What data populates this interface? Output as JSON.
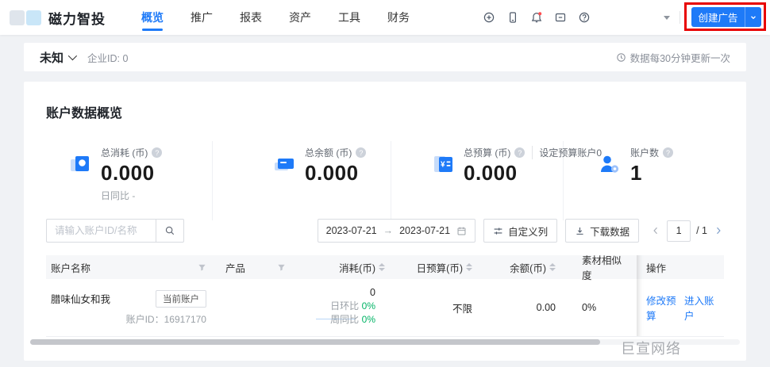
{
  "topnav": {
    "brand": "磁力智投",
    "menu": [
      {
        "label": "概览"
      },
      {
        "label": "推广"
      },
      {
        "label": "报表"
      },
      {
        "label": "资产"
      },
      {
        "label": "工具"
      },
      {
        "label": "财务"
      }
    ],
    "create_ad_label": "创建广告"
  },
  "subheader": {
    "account_name": "未知",
    "enterprise_id": "企业ID: 0",
    "update_note": "数据每30分钟更新一次"
  },
  "overview": {
    "title": "账户数据概览",
    "cards": [
      {
        "label": "总消耗 (币)",
        "value": "0.000",
        "sub": "日同比 -"
      },
      {
        "label": "总余额 (币)",
        "value": "0.000"
      },
      {
        "label": "总预算 (币)",
        "extra": "设定预算账户0",
        "value": "0.000"
      },
      {
        "label": "账户数",
        "value": "1"
      }
    ]
  },
  "filters": {
    "search_placeholder": "请输入账户ID/名称",
    "date_start": "2023-07-21",
    "date_separator": "→",
    "date_end": "2023-07-21",
    "customize_columns_label": "自定义列",
    "download_label": "下载数据",
    "page_current": "1",
    "page_total": "/ 1"
  },
  "table": {
    "headers": [
      "账户名称",
      "产品",
      "消耗(币)",
      "日预算(币)",
      "余额(币)",
      "素材相似度",
      "操作"
    ],
    "row": {
      "account_name": "腊味仙女和我",
      "badge": "当前账户",
      "account_id": "账户ID：16917170",
      "spend_value": "0",
      "day_ratio_label": "日环比",
      "day_ratio_value": "0%",
      "week_ratio_label": "周同比",
      "week_ratio_value": "0%",
      "daily_budget": "不限",
      "balance": "0.00",
      "similarity": "0%",
      "action_modify": "修改预算",
      "action_enter": "进入账户"
    }
  },
  "footer": {
    "watermark": "巨宣网络"
  },
  "colors": {
    "primary": "#1e7af8",
    "positive_green": "#00b365",
    "annotation_red": "#e80000",
    "badge_border": "#d9dce1"
  },
  "icons": {
    "help_glyph": "?"
  }
}
